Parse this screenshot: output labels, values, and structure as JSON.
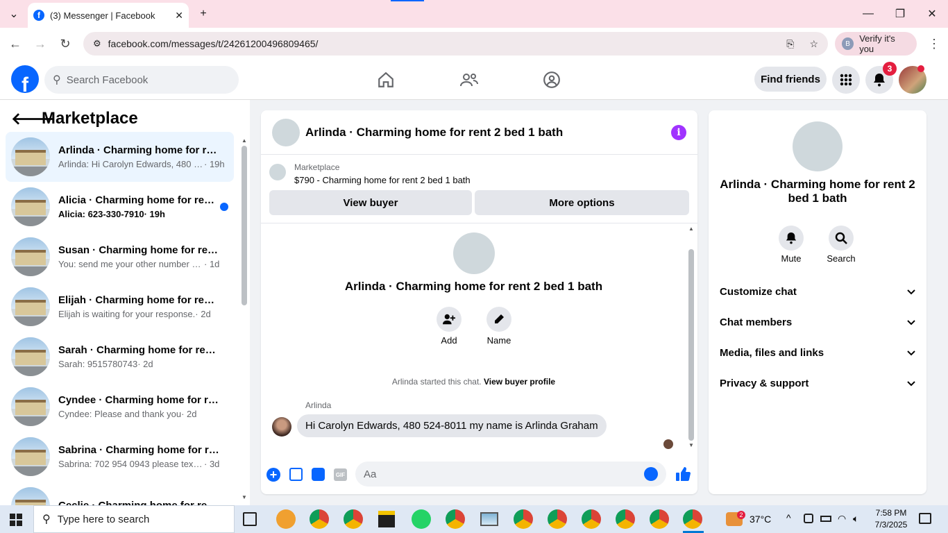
{
  "browser": {
    "tab_title": "(3) Messenger | Facebook",
    "url": "facebook.com/messages/t/24261200496809465/",
    "verify_label": "Verify it's you",
    "profile_initial": "B"
  },
  "fb_header": {
    "search_placeholder": "Search Facebook",
    "find_friends": "Find friends",
    "notification_count": "3"
  },
  "sidebar": {
    "title": "Marketplace",
    "conversations": [
      {
        "name": "Arlinda · Charming home for ren...",
        "preview": "Arlinda: Hi Carolyn Edwards, 480 5...",
        "time": "19h",
        "active": true,
        "unread": false
      },
      {
        "name": "Alicia · Charming home for ren...",
        "preview": "Alicia: 623-330-7910",
        "time": "19h",
        "active": false,
        "unread": true
      },
      {
        "name": "Susan · Charming home for rent...",
        "preview": "You: send me your other number p...",
        "time": "1d",
        "active": false,
        "unread": false
      },
      {
        "name": "Elijah · Charming home for rent ...",
        "preview": "Elijah is waiting for your response.",
        "time": "2d",
        "active": false,
        "unread": false
      },
      {
        "name": "Sarah · Charming home for rent ...",
        "preview": "Sarah: 9515780743",
        "time": "2d",
        "active": false,
        "unread": false
      },
      {
        "name": "Cyndee · Charming home for re...",
        "preview": "Cyndee: Please and thank you",
        "time": "2d",
        "active": false,
        "unread": false
      },
      {
        "name": "Sabrina · Charming home for re...",
        "preview": "Sabrina: 702 954 0943 please text ...",
        "time": "3d",
        "active": false,
        "unread": false
      },
      {
        "name": "Ceclie · Charming home for rent...",
        "preview": "",
        "time": "",
        "active": false,
        "unread": false
      }
    ]
  },
  "chat": {
    "title": "Arlinda · Charming home for rent 2 bed 1 bath",
    "marketplace_label": "Marketplace",
    "listing": "$790 - Charming home for rent 2 bed 1 bath",
    "view_buyer": "View buyer",
    "more_options": "More options",
    "intro_title": "Arlinda · Charming home for rent 2 bed 1 bath",
    "add_label": "Add",
    "name_label": "Name",
    "started_text": "Arlinda started this chat.",
    "view_profile": "View buyer profile",
    "sender": "Arlinda",
    "message": "Hi Carolyn Edwards, 480 524-8011 my name is Arlinda Graham",
    "composer_placeholder": "Aa"
  },
  "info_panel": {
    "title": "Arlinda · Charming home for rent 2 bed 1 bath",
    "mute": "Mute",
    "search": "Search",
    "sections": [
      "Customize chat",
      "Chat members",
      "Media, files and links",
      "Privacy & support"
    ]
  },
  "taskbar": {
    "search_placeholder": "Type here to search",
    "temperature": "37°C",
    "weather_badge": "2",
    "time": "7:58 PM",
    "date": "7/3/2025"
  },
  "colors": {
    "accent": "#0866ff",
    "info": "#a033ff",
    "badge": "#e41e3f"
  }
}
